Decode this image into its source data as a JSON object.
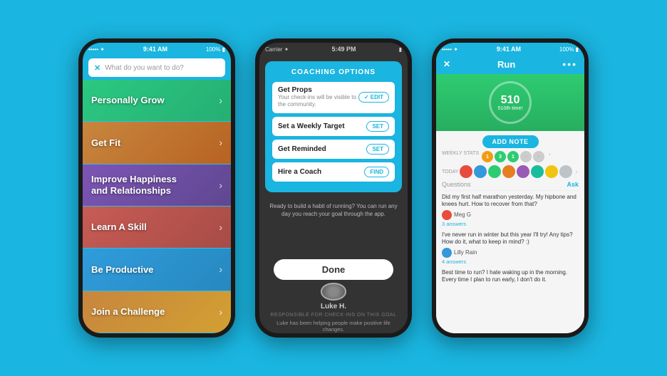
{
  "background": "#1ab5e0",
  "phone1": {
    "statusBar": {
      "left": "•••••  ✦",
      "time": "9:41 AM",
      "right": "100% ▮"
    },
    "searchBar": {
      "placeholder": "What do you want to do?"
    },
    "menuItems": [
      {
        "id": "personally-grow",
        "label": "Personally Grow"
      },
      {
        "id": "get-fit",
        "label": "Get Fit"
      },
      {
        "id": "improve-happiness",
        "label": "Improve Happiness and Relationships"
      },
      {
        "id": "learn-skill",
        "label": "Learn A Skill"
      },
      {
        "id": "be-productive",
        "label": "Be Productive"
      },
      {
        "id": "join-challenge",
        "label": "Join a Challenge"
      }
    ]
  },
  "phone2": {
    "statusBar": {
      "left": "Carrier  ✦",
      "time": "5:49 PM",
      "right": "▮"
    },
    "modal": {
      "title": "COACHING OPTIONS",
      "options": [
        {
          "id": "get-props",
          "title": "Get Props",
          "subtitle": "Your check-ins will be visible to the community.",
          "btnLabel": "✓ EDIT",
          "btnType": "edit"
        },
        {
          "id": "weekly-target",
          "title": "Set a Weekly Target",
          "subtitle": "",
          "btnLabel": "SET",
          "btnType": "set"
        },
        {
          "id": "get-reminded",
          "title": "Get Reminded",
          "subtitle": "",
          "btnLabel": "SET",
          "btnType": "set"
        },
        {
          "id": "hire-coach",
          "title": "Hire a Coach",
          "subtitle": "",
          "btnLabel": "FIND",
          "btnType": "find"
        }
      ]
    },
    "doneBtn": "Done",
    "coachName": "Luke H.",
    "coachLabel": "RESPONSIBLE FOR CHECK-INS ON THIS GOAL",
    "coachDesc": "Luke has been helping people make positive life changes."
  },
  "phone3": {
    "statusBar": {
      "left": "•••••  ✦",
      "time": "9:41 AM",
      "right": "100% ▮"
    },
    "header": {
      "title": "Run",
      "dotsBtn": "•••"
    },
    "runCircle": {
      "count": "510",
      "sub": "510th time!"
    },
    "addNoteBtn": "ADD NOTE",
    "stats": {
      "weekly": "WEEKLY STATS",
      "today": "TODAY"
    },
    "questions": {
      "header": "Questions",
      "askBtn": "Ask",
      "items": [
        {
          "text": "Did my first half marathon yesterday. My hipbone and knees hurt. How to recover from that?",
          "user": "Meg G",
          "answers": "3 answers"
        },
        {
          "text": "I've never run in winter but this year I'll try! Any tips? How do it, what to keep in mind? :)",
          "user": "Lilly Rain",
          "answers": "4 answers"
        },
        {
          "text": "Best time to run? I hate waking up in the morning. Every time I plan to run early, I don't do it.",
          "user": "",
          "answers": ""
        }
      ]
    }
  }
}
